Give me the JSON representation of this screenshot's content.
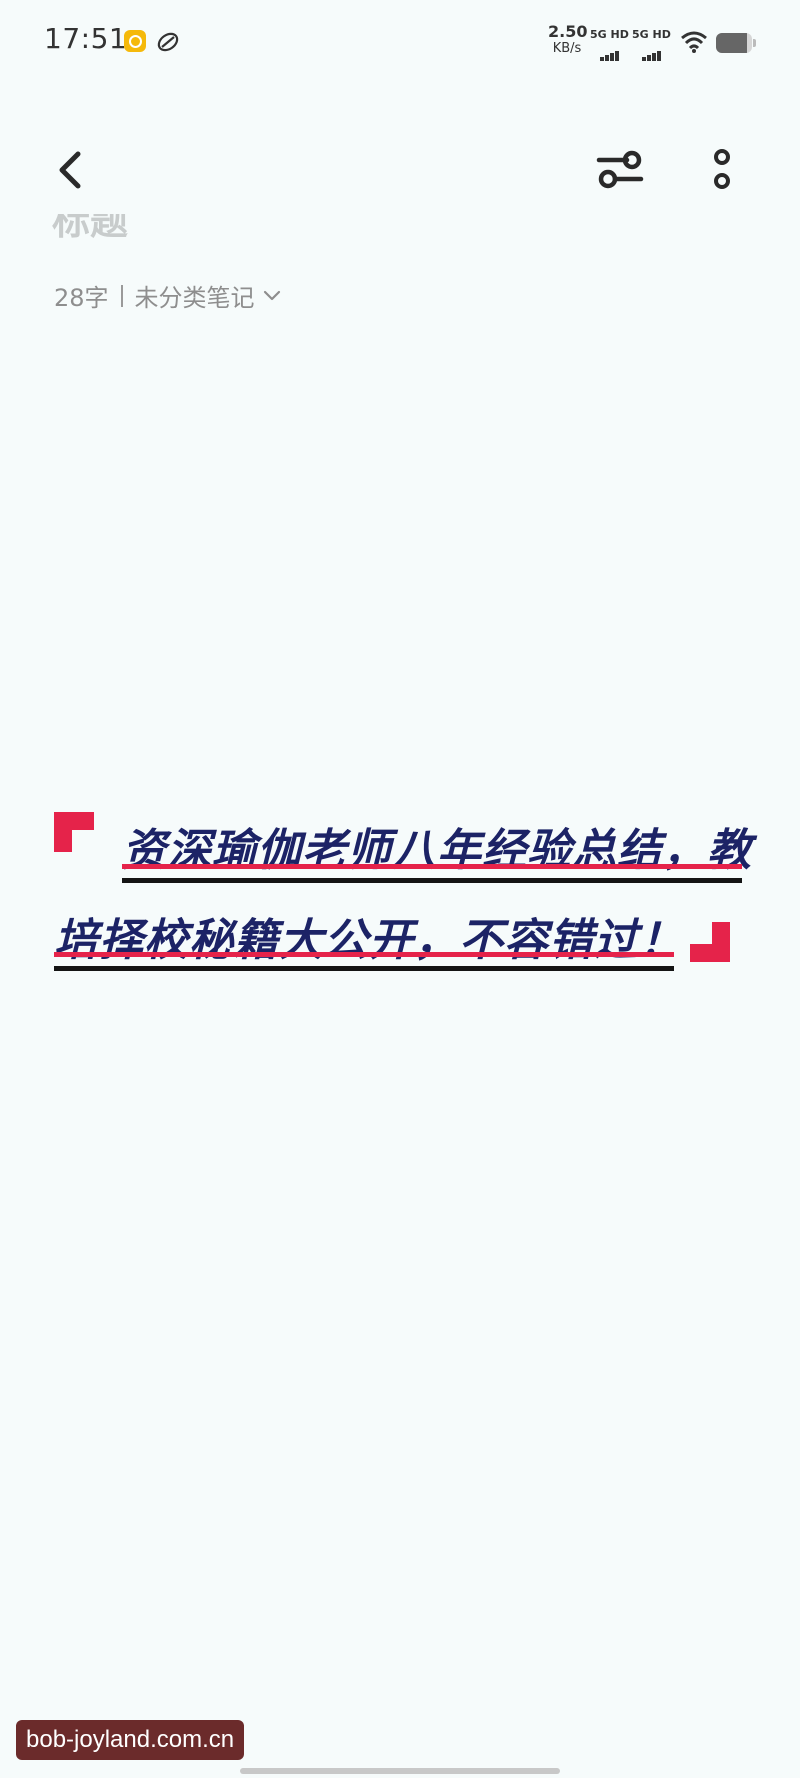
{
  "status_bar": {
    "time": "17:51",
    "net_speed_value": "2.50",
    "net_speed_unit": "KB/s",
    "sim1_label": "5G HD",
    "sim2_label": "5G HD",
    "battery_level": 0.85
  },
  "toolbar": {
    "back_icon": "chevron-left-icon",
    "format_icon": "sliders-icon",
    "more_icon": "vertical-dots-icon"
  },
  "note": {
    "title": "标题",
    "word_count": "28字",
    "category": "未分类笔记"
  },
  "banner": {
    "line1": "资深瑜伽老师八年经验总结，教",
    "line2": "培择校秘籍大公开，不容错过！",
    "accent_color": "#e5234a",
    "text_color": "#1c2366"
  },
  "watermark": "bob-joyland.com.cn"
}
